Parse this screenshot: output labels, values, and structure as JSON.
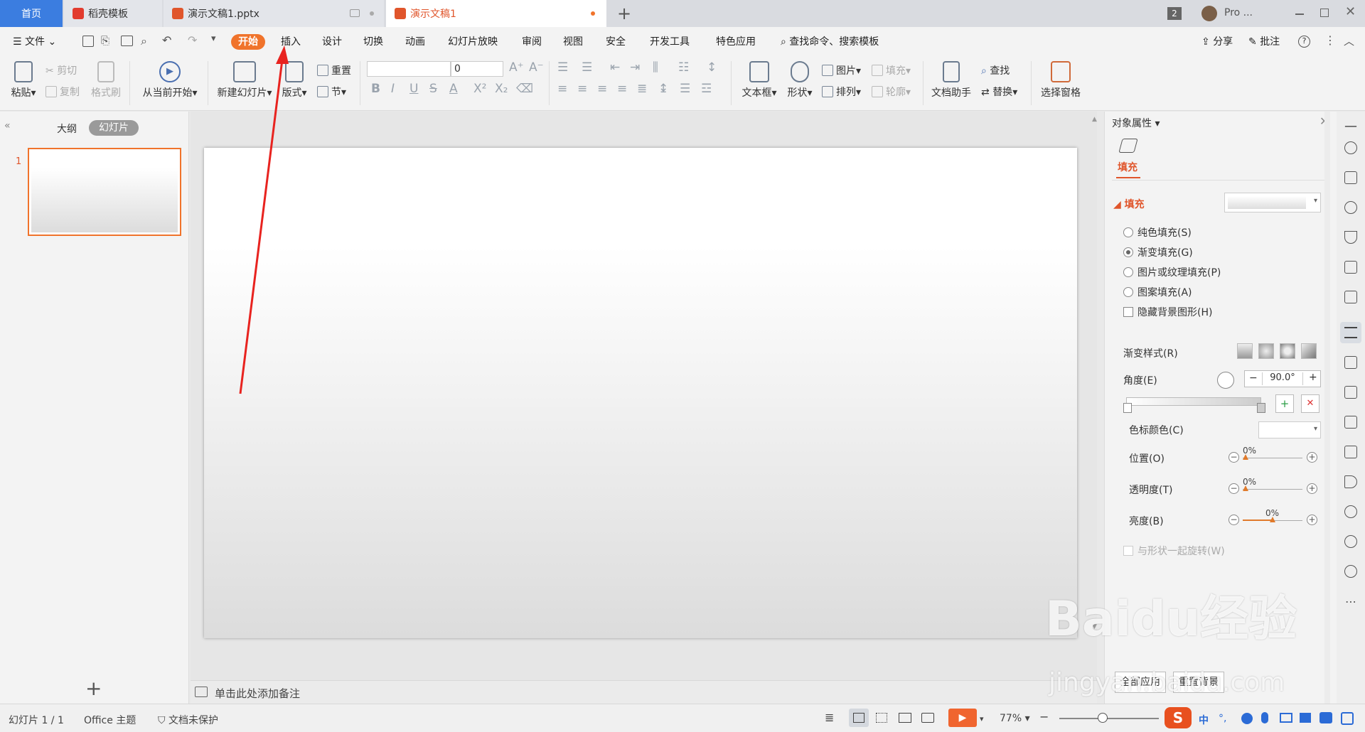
{
  "tabs": {
    "home": "首页",
    "daoke": "稻壳模板",
    "file1": "演示文稿1.pptx",
    "file2": "演示文稿1",
    "add": "+",
    "badge": "2",
    "user": "Pro ..."
  },
  "menu": {
    "file": "文件",
    "items": [
      "开始",
      "插入",
      "设计",
      "切换",
      "动画",
      "幻灯片放映",
      "审阅",
      "视图",
      "安全",
      "开发工具",
      "特色应用"
    ],
    "search": "查找命令、搜索模板",
    "share": "分享",
    "comment": "批注"
  },
  "ribbon": {
    "paste": "粘贴",
    "cut": "剪切",
    "copy": "复制",
    "format_painter": "格式刷",
    "from_current": "从当前开始",
    "new_slide": "新建幻灯片",
    "layout": "版式",
    "reset": "重置",
    "section": "节",
    "font_size": "0",
    "textbox": "文本框",
    "shape": "形状",
    "picture": "图片",
    "arrange": "排列",
    "fill": "填充",
    "outline": "轮廓",
    "doc_helper": "文档助手",
    "find": "查找",
    "replace": "替换",
    "select_pane": "选择窗格"
  },
  "leftpane": {
    "outline_tab": "大纲",
    "slides_tab": "幻灯片",
    "slide_number": "1",
    "add": "+"
  },
  "notes": {
    "placeholder": "单击此处添加备注"
  },
  "rightpanel": {
    "title": "对象属性",
    "fill_tab": "填充",
    "fill_section": "填充",
    "opt_solid": "纯色填充(S)",
    "opt_gradient": "渐变填充(G)",
    "opt_picture": "图片或纹理填充(P)",
    "opt_pattern": "图案填充(A)",
    "opt_hide_bg": "隐藏背景图形(H)",
    "gradient_style": "渐变样式(R)",
    "angle": "角度(E)",
    "angle_value": "90.0°",
    "stop_color": "色标颜色(C)",
    "position": "位置(O)",
    "position_value": "0%",
    "transparency": "透明度(T)",
    "transparency_value": "0%",
    "brightness": "亮度(B)",
    "brightness_value": "0%",
    "rotate_with_shape": "与形状一起旋转(W)",
    "apply_all": "全部应用",
    "reset_bg": "重置背景"
  },
  "status": {
    "slide_pos": "幻灯片 1 / 1",
    "theme": "Office 主题",
    "protect": "文档未保护",
    "zoom": "77%"
  },
  "watermark": {
    "brand": "Baidu经验",
    "url": "jingyan.baidu.com"
  },
  "colors": {
    "accent": "#f0732b",
    "home_tab": "#3b7de0",
    "arrow": "#e8231f"
  }
}
